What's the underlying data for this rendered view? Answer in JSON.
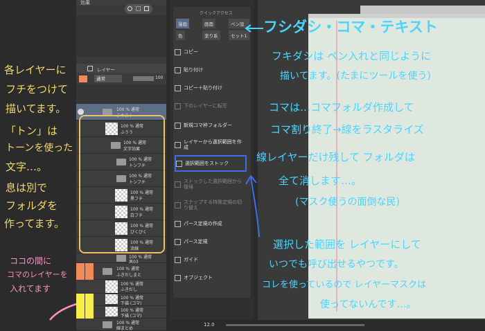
{
  "left_notes": {
    "line1": "各レイヤーに",
    "line2": "フチをつけて",
    "line3": "描いてます。",
    "line4": "「トン」は",
    "line5": "トーンを使った",
    "line6": "文字…。",
    "line7": "息は別で",
    "line8": "フォルダを",
    "line9": "作ってます。",
    "bottom1": "ココの間に",
    "bottom2": "コマのレイヤーを",
    "bottom3": "入れてます"
  },
  "layer_panel": {
    "effect_label": "効果",
    "tab_label": "レイヤー",
    "blend_mode": "通常",
    "opacity": "100",
    "layers": [
      {
        "line1": "100 % 通常",
        "line2": "テキスト"
      },
      {
        "line1": "100 % 通常",
        "line2": "ふうう"
      },
      {
        "line1": "100 % 通常",
        "line2": "文字効果"
      },
      {
        "line1": "100 % 通常",
        "line2": "トンフチ"
      },
      {
        "line1": "100 % 通常",
        "line2": "トンフチ"
      },
      {
        "line1": "100 % 通常",
        "line2": "黒フチ"
      },
      {
        "line1": "100 % 通常",
        "line2": "白フチ"
      },
      {
        "line1": "100 % 通常",
        "line2": "びくびく"
      },
      {
        "line1": "100 % 通常",
        "line2": "流線"
      },
      {
        "line1": "100 % 通常",
        "line2": "息03"
      },
      {
        "line1": "100 % 通常",
        "line2": "ふきだしまと"
      },
      {
        "line1": "100 % 通常",
        "line2": "ふきだし"
      },
      {
        "line1": "100 % 通常",
        "line2": "下描 (コマ)"
      },
      {
        "line1": "100 % 通常",
        "line2": "下描 (コマ)"
      },
      {
        "line1": "100 % 通常",
        "line2": "線まとめ"
      }
    ]
  },
  "quick_access": {
    "title": "クイックアクセス",
    "tabs": [
      "漫画",
      "画面",
      "ペン設定",
      "色",
      "塗り系",
      "セット1"
    ],
    "items": [
      "コピー",
      "貼り付け",
      "コピー＋貼り付け",
      "下のレイヤーに転写",
      "新規コマ枠フォルダー",
      "レイヤーから選択範囲を作成",
      "選択範囲をストック",
      "ストックした選択範囲から復帰",
      "スナップする特殊定規の切り替え",
      "パース定規の作成",
      "パース定規",
      "ガイド",
      "オブジェクト"
    ],
    "zoom": "12.0"
  },
  "right_notes": {
    "heading": "フシダシ・コマ・テキスト",
    "fuki1": "フキダシは ペン入れと同じように",
    "fuki2": "描いてます。(たまにツールを使う)",
    "koma1": "コマは…コマフォルダ作成して",
    "koma2": "コマ割り終了→線をラスタライズ",
    "koma3": "線レイヤーだけ残して フォルダは",
    "koma4": "全て消します…。",
    "koma5": "(マスク使うの面倒な民)",
    "sel1": "選択した範囲を レイヤーにして",
    "sel2": "いつでも呼び出せるやつです。",
    "sel3": "コレを使っているので レイヤーマスクは",
    "sel4": "使ってないんです…。"
  },
  "colors": {
    "handwriting_left": "#f4d86a",
    "handwriting_right": "#4ad4ff",
    "handwriting_pink": "#ff8fc8",
    "selection_box": "#3f6df0"
  }
}
